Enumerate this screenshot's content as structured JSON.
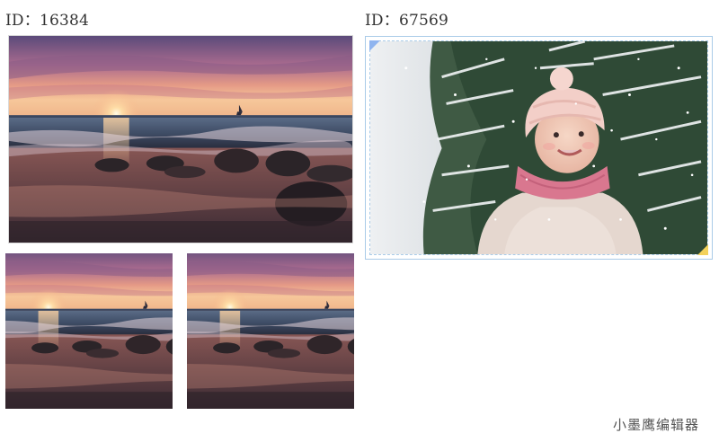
{
  "left_panel": {
    "id_label": "ID：16384"
  },
  "right_panel": {
    "id_label": "ID：67569"
  },
  "watermark": "小墨鹰编辑器",
  "colors": {
    "frame_border": "#a9cbe8",
    "corner_tl": "#8fb4ef",
    "corner_br": "#f3d15b"
  },
  "images": [
    {
      "name": "sunset-beach-photo-main",
      "subject": "sunset over sea with rocks"
    },
    {
      "name": "sunset-beach-photo-small-1",
      "subject": "sunset over sea with rocks"
    },
    {
      "name": "sunset-beach-photo-small-2",
      "subject": "sunset over sea with rocks"
    },
    {
      "name": "winter-child-photo",
      "subject": "child in pink hat in snow"
    }
  ]
}
